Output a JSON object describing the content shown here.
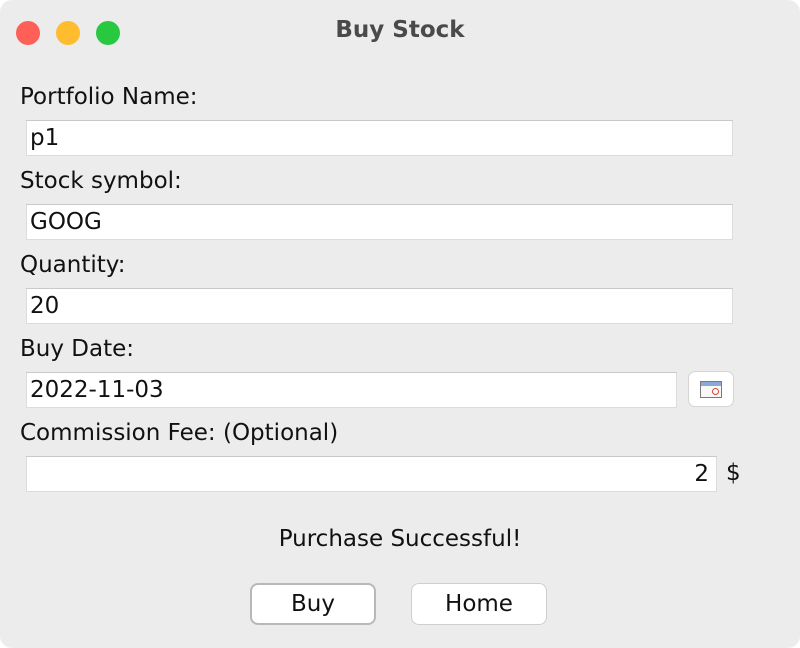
{
  "window": {
    "title": "Buy Stock"
  },
  "form": {
    "portfolio_label": "Portfolio Name:",
    "portfolio_value": "p1",
    "symbol_label": "Stock symbol:",
    "symbol_value": "GOOG",
    "quantity_label": "Quantity:",
    "quantity_value": "20",
    "date_label": "Buy Date:",
    "date_value": "2022-11-03",
    "fee_label": "Commission Fee: (Optional)",
    "fee_value": "2",
    "fee_unit": "$"
  },
  "status": {
    "message": "Purchase Successful!"
  },
  "buttons": {
    "buy_label": "Buy",
    "home_label": "Home"
  },
  "icons": {
    "calendar": "calendar-icon"
  },
  "colors": {
    "close": "#fe5f57",
    "minimize": "#febc2e",
    "maximize": "#28c840",
    "window_bg": "#ececec"
  }
}
